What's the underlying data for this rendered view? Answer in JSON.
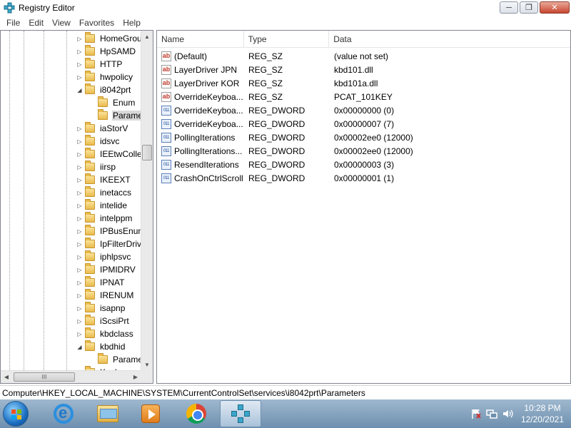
{
  "window": {
    "title": "Registry Editor",
    "minimize": "─",
    "restore": "❐",
    "close": "✕"
  },
  "menu": [
    "File",
    "Edit",
    "View",
    "Favorites",
    "Help"
  ],
  "tree": {
    "items": [
      {
        "label": "HomeGrou",
        "expander": "▷",
        "indent": 0
      },
      {
        "label": "HpSAMD",
        "expander": "▷",
        "indent": 0
      },
      {
        "label": "HTTP",
        "expander": "▷",
        "indent": 0
      },
      {
        "label": "hwpolicy",
        "expander": "▷",
        "indent": 0
      },
      {
        "label": "i8042prt",
        "expander": "◢",
        "indent": 0
      },
      {
        "label": "Enum",
        "expander": "",
        "indent": 1
      },
      {
        "label": "Parame",
        "expander": "",
        "indent": 1,
        "selected": true
      },
      {
        "label": "iaStorV",
        "expander": "▷",
        "indent": 0
      },
      {
        "label": "idsvc",
        "expander": "▷",
        "indent": 0
      },
      {
        "label": "IEEtwColle",
        "expander": "▷",
        "indent": 0
      },
      {
        "label": "iirsp",
        "expander": "▷",
        "indent": 0
      },
      {
        "label": "IKEEXT",
        "expander": "▷",
        "indent": 0
      },
      {
        "label": "inetaccs",
        "expander": "▷",
        "indent": 0
      },
      {
        "label": "intelide",
        "expander": "▷",
        "indent": 0
      },
      {
        "label": "intelppm",
        "expander": "▷",
        "indent": 0
      },
      {
        "label": "IPBusEnum",
        "expander": "▷",
        "indent": 0
      },
      {
        "label": "IpFilterDriv",
        "expander": "▷",
        "indent": 0
      },
      {
        "label": "iphlpsvc",
        "expander": "▷",
        "indent": 0
      },
      {
        "label": "IPMIDRV",
        "expander": "▷",
        "indent": 0
      },
      {
        "label": "IPNAT",
        "expander": "▷",
        "indent": 0
      },
      {
        "label": "IRENUM",
        "expander": "▷",
        "indent": 0
      },
      {
        "label": "isapnp",
        "expander": "▷",
        "indent": 0
      },
      {
        "label": "iScsiPrt",
        "expander": "▷",
        "indent": 0
      },
      {
        "label": "kbdclass",
        "expander": "▷",
        "indent": 0
      },
      {
        "label": "kbdhid",
        "expander": "◢",
        "indent": 0
      },
      {
        "label": "Parame",
        "expander": "",
        "indent": 1
      },
      {
        "label": "KeyIso",
        "expander": "▷",
        "indent": 0
      }
    ],
    "hscroll_thumb_label": "III"
  },
  "list": {
    "columns": [
      "Name",
      "Type",
      "Data"
    ],
    "rows": [
      {
        "name": "(Default)",
        "type": "REG_SZ",
        "data": "(value not set)",
        "icon": "ab"
      },
      {
        "name": "LayerDriver JPN",
        "type": "REG_SZ",
        "data": "kbd101.dll",
        "icon": "ab"
      },
      {
        "name": "LayerDriver KOR",
        "type": "REG_SZ",
        "data": "kbd101a.dll",
        "icon": "ab"
      },
      {
        "name": "OverrideKeyboa...",
        "type": "REG_SZ",
        "data": "PCAT_101KEY",
        "icon": "ab"
      },
      {
        "name": "OverrideKeyboa...",
        "type": "REG_DWORD",
        "data": "0x00000000 (0)",
        "icon": "011"
      },
      {
        "name": "OverrideKeyboa...",
        "type": "REG_DWORD",
        "data": "0x00000007 (7)",
        "icon": "011"
      },
      {
        "name": "PollingIterations",
        "type": "REG_DWORD",
        "data": "0x00002ee0 (12000)",
        "icon": "011"
      },
      {
        "name": "PollingIterations...",
        "type": "REG_DWORD",
        "data": "0x00002ee0 (12000)",
        "icon": "011"
      },
      {
        "name": "ResendIterations",
        "type": "REG_DWORD",
        "data": "0x00000003 (3)",
        "icon": "011"
      },
      {
        "name": "CrashOnCtrlScroll",
        "type": "REG_DWORD",
        "data": "0x00000001 (1)",
        "icon": "011"
      }
    ]
  },
  "status": {
    "path": "Computer\\HKEY_LOCAL_MACHINE\\SYSTEM\\CurrentControlSet\\services\\i8042prt\\Parameters"
  },
  "taskbar": {
    "apps": [
      "internet-explorer-icon",
      "windows-explorer-icon",
      "media-player-icon",
      "chrome-icon",
      "regedit-icon"
    ],
    "tray_icons": [
      "flag-icon",
      "network-icon",
      "volume-icon"
    ],
    "time": "10:28 PM",
    "date": "12/20/2021"
  }
}
